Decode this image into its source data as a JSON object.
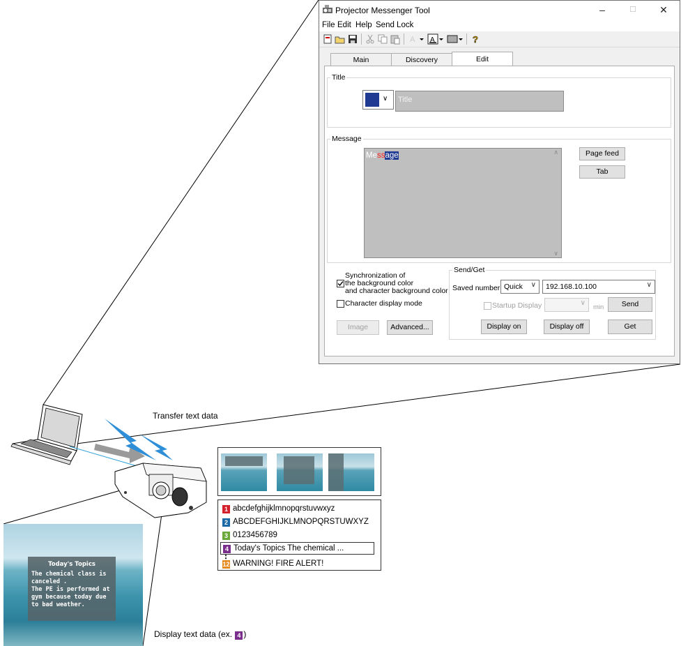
{
  "window": {
    "title": "Projector Messenger Tool",
    "controls": {
      "minimize": "–",
      "maximize": "☐",
      "close": "✕"
    }
  },
  "menu": [
    {
      "label": "File"
    },
    {
      "label": "Edit"
    },
    {
      "label": "Help"
    },
    {
      "label": "Send Lock"
    }
  ],
  "tabs": [
    {
      "label": "Main",
      "active": false
    },
    {
      "label": "Discovery",
      "active": false
    },
    {
      "label": "Edit",
      "active": true
    }
  ],
  "title_group": {
    "label": "Title",
    "color": "#1f3a93",
    "input_placeholder": "Title"
  },
  "message_group": {
    "label": "Message",
    "text_parts": [
      {
        "text": "Me",
        "fg": "#ffffff",
        "bg": "transparent"
      },
      {
        "text": "ss",
        "fg": "#ff2020",
        "bg": "transparent"
      },
      {
        "text": "age",
        "fg": "#ffffff",
        "bg": "#1f3a93"
      }
    ],
    "page_feed_label": "Page feed",
    "tab_label": "Tab"
  },
  "options": {
    "sync_line1": "Synchronization of",
    "sync_line2": "the background color",
    "sync_line3": "and character background color",
    "sync_checked": true,
    "char_mode_label": "Character display mode",
    "char_mode_checked": false,
    "image_label": "Image",
    "advanced_label": "Advanced..."
  },
  "send_get": {
    "label": "Send/Get",
    "saved_number_label": "Saved number",
    "saved_number_value": "Quick",
    "ip_value": "192.168.10.100",
    "startup_label": "Startup Display",
    "min_label": "min",
    "send_label": "Send",
    "display_on_label": "Display on",
    "display_off_label": "Display off",
    "get_label": "Get"
  },
  "diagram": {
    "transfer_caption": "Transfer text data",
    "display_caption": "Display text data (ex. ",
    "display_caption_end": ")",
    "display_caption_badge": "4"
  },
  "list": {
    "items": [
      {
        "num": "1",
        "color": "#d4202a",
        "text": "abcdefghijklmnopqrstuvwxyz"
      },
      {
        "num": "2",
        "color": "#1b6aa5",
        "text": "ABCDEFGHIJKLMNOPQRSTUWXYZ"
      },
      {
        "num": "3",
        "color": "#6aa83a",
        "text": "0123456789"
      },
      {
        "num": "4",
        "color": "#7a2e8c",
        "text": "Today's Topics The chemical ..."
      },
      {
        "num": "12",
        "color": "#e58a1f",
        "text": "WARNING! FIRE ALERT!"
      }
    ],
    "ellipsis": "⋮"
  },
  "screen": {
    "heading": "Today's Topics",
    "lines": [
      "The chemical class is",
      "canceled .",
      "The PE is performed at",
      "gym because today due",
      "to bad weather."
    ]
  }
}
